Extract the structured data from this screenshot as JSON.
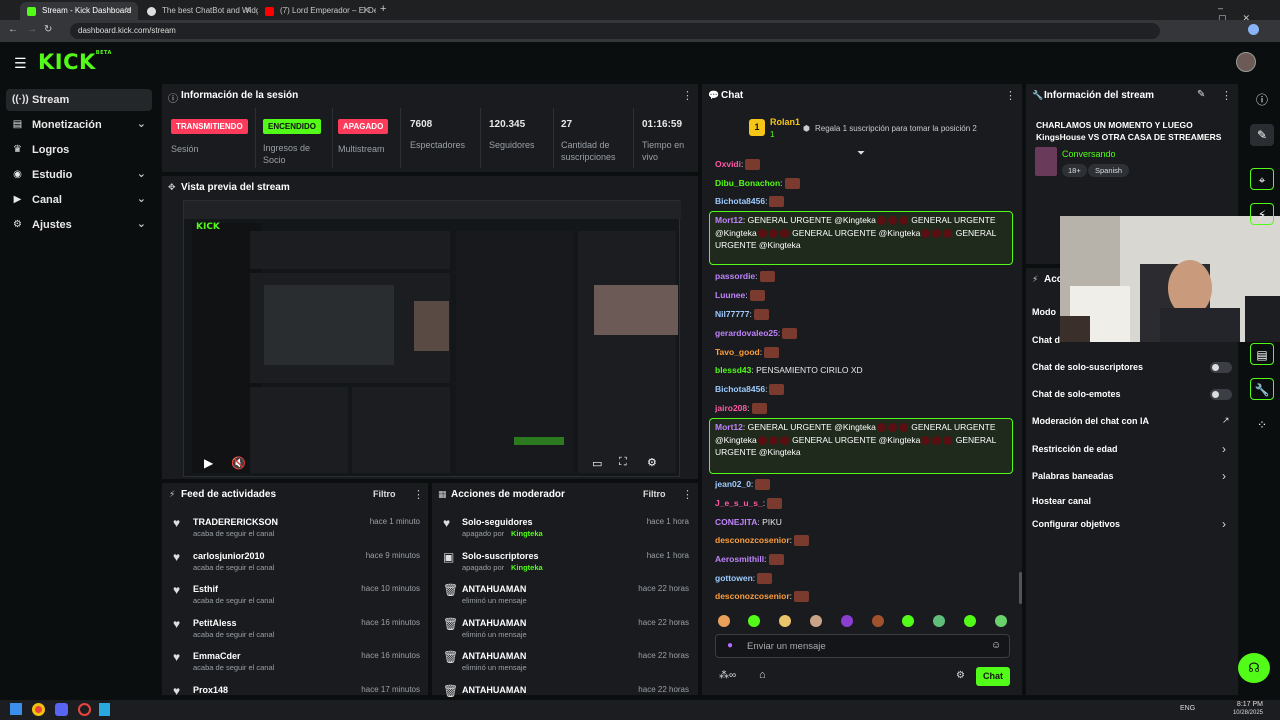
{
  "browser": {
    "tabs": [
      {
        "label": "Stream - Kick Dashboard"
      },
      {
        "label": "The best ChatBot and Widgets"
      },
      {
        "label": "(7) Lord Emperador – El Despe"
      }
    ],
    "url": "dashboard.kick.com/stream"
  },
  "header": {
    "logo": "KICK",
    "logo_sup": "BETA"
  },
  "sidebar": {
    "items": [
      {
        "label": "Stream"
      },
      {
        "label": "Monetización"
      },
      {
        "label": "Logros"
      },
      {
        "label": "Estudio"
      },
      {
        "label": "Canal"
      },
      {
        "label": "Ajustes"
      }
    ]
  },
  "session": {
    "title": "Información de la sesión",
    "stats": [
      {
        "value": "TRANSMITIENDO",
        "label": "Sesión",
        "color": "#ff3b5c"
      },
      {
        "value": "ENCENDIDO",
        "label": "Ingresos de Socio",
        "color": "#53fc18"
      },
      {
        "value": "APAGADO",
        "label": "Multistream",
        "color": "#ff3b5c"
      },
      {
        "value": "7608",
        "label": "Espectadores"
      },
      {
        "value": "120.345",
        "label": "Seguidores"
      },
      {
        "value": "27",
        "label": "Cantidad de suscripciones"
      },
      {
        "value": "01:16:59",
        "label": "Tiempo en vivo"
      }
    ]
  },
  "preview": {
    "title": "Vista previa del stream"
  },
  "activity": {
    "title": "Feed de actividades",
    "filter": "Filtro",
    "items": [
      {
        "name": "TRADERERICKSON",
        "sub": "acaba de seguir el canal",
        "time": "hace 1 minuto"
      },
      {
        "name": "carlosjunior2010",
        "sub": "acaba de seguir el canal",
        "time": "hace 9 minutos"
      },
      {
        "name": "Esthif",
        "sub": "acaba de seguir el canal",
        "time": "hace 10 minutos"
      },
      {
        "name": "PetitAless",
        "sub": "acaba de seguir el canal",
        "time": "hace 16 minutos"
      },
      {
        "name": "EmmaCder",
        "sub": "acaba de seguir el canal",
        "time": "hace 16 minutos"
      },
      {
        "name": "Prox148",
        "sub": "",
        "time": "hace 17 minutos"
      }
    ]
  },
  "moderator": {
    "title": "Acciones de moderador",
    "filter": "Filtro",
    "items": [
      {
        "name": "Solo-seguidores",
        "sub": "apagado por",
        "by": "Kingteka",
        "time": "hace 1 hora",
        "icon": "heart-icon"
      },
      {
        "name": "Solo-suscriptores",
        "sub": "apagado por",
        "by": "Kingteka",
        "time": "hace 1 hora",
        "icon": "gift-icon"
      },
      {
        "name": "ANTAHUAMAN",
        "sub": "eliminó un mensaje",
        "by": "",
        "time": "hace 22 horas",
        "icon": "trash-icon"
      },
      {
        "name": "ANTAHUAMAN",
        "sub": "eliminó un mensaje",
        "by": "",
        "time": "hace 22 horas",
        "icon": "trash-icon"
      },
      {
        "name": "ANTAHUAMAN",
        "sub": "eliminó un mensaje",
        "by": "",
        "time": "hace 22 horas",
        "icon": "trash-icon"
      },
      {
        "name": "ANTAHUAMAN",
        "sub": "",
        "by": "",
        "time": "hace 22 horas",
        "icon": "trash-icon"
      }
    ]
  },
  "chat": {
    "title": "Chat",
    "pinned_user": "Rolan1",
    "pinned_count": "1",
    "pinned_rank": "1",
    "gift_prompt": "Regala 1 suscripción para tomar la posición 2",
    "messages": [
      {
        "user": "Oxvidi",
        "text": ":",
        "color": "#ff5aa5"
      },
      {
        "user": "Dibu_Bonachon",
        "text": ":",
        "color": "#53fc18"
      },
      {
        "user": "Bichota8456",
        "text": ":",
        "color": "#9ecbff"
      },
      {
        "user": "passordie",
        "text": ":",
        "color": "#c084fc"
      },
      {
        "user": "Luunee",
        "text": ":",
        "color": "#c084fc"
      },
      {
        "user": "Nil77777",
        "text": ":",
        "color": "#9ecbff"
      },
      {
        "user": "gerardovaleo25",
        "text": ":",
        "color": "#c084fc"
      },
      {
        "user": "Tavo_good",
        "text": ":",
        "color": "#ff9e3b"
      },
      {
        "user": "blessd43",
        "text": ": PENSAMIENTO CIRILO XD",
        "color": "#53fc18"
      },
      {
        "user": "Bichota8456",
        "text": ":",
        "color": "#9ecbff"
      },
      {
        "user": "jairo208",
        "text": ":",
        "color": "#ff5aa5"
      },
      {
        "user": "jean02_0",
        "text": ":",
        "color": "#9ecbff"
      },
      {
        "user": "J_e_s_u_s_",
        "text": ":",
        "color": "#ff5aa5"
      },
      {
        "user": "CONEJITA",
        "text": ": PIKU",
        "color": "#c084fc"
      },
      {
        "user": "desconozcosenior",
        "text": ":",
        "color": "#ff9e3b"
      },
      {
        "user": "Aerosmithill",
        "text": ":",
        "color": "#c084fc"
      },
      {
        "user": "gottowen",
        "text": ":",
        "color": "#9ecbff"
      },
      {
        "user": "desconozcosenior",
        "text": ":",
        "color": "#ff9e3b"
      }
    ],
    "highlight": {
      "user": "Mort12",
      "text": "GENERAL URGENTE @Kingteka"
    },
    "input_placeholder": "Enviar un mensaje",
    "send_label": "Chat"
  },
  "stream_info": {
    "title": "Información del stream",
    "stream_title": "CHARLAMOS UN MOMENTO Y LUEGO KingsHouse VS OTRA CASA DE STREAMERS",
    "category": "Conversando",
    "tags": [
      "18+",
      "Spanish"
    ]
  },
  "actions": {
    "title": "Acc",
    "mode_label": "Modo",
    "chat_d": "Chat d",
    "rows": [
      {
        "label": "Chat de solo-suscriptores",
        "type": "toggle"
      },
      {
        "label": "Chat de solo-emotes",
        "type": "toggle"
      },
      {
        "label": "Moderación del chat con IA",
        "type": "external"
      },
      {
        "label": "Restricción de edad",
        "type": "chevron"
      },
      {
        "label": "Palabras baneadas",
        "type": "chevron"
      },
      {
        "label": "Hostear canal",
        "type": "none"
      },
      {
        "label": "Configurar objetivos",
        "type": "chevron"
      }
    ]
  },
  "taskbar": {
    "lang": "ENG",
    "time": "8:17 PM",
    "date": "10/28/2025"
  },
  "colors": {
    "accent": "#53fc18",
    "live_red": "#ff3b5c",
    "panel": "#191b1f",
    "bg": "#0b0e0f"
  }
}
